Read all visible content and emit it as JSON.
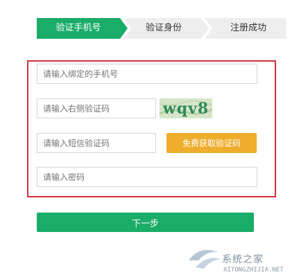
{
  "stepper": {
    "steps": [
      {
        "label": "验证手机号",
        "active": true
      },
      {
        "label": "验证身份",
        "active": false
      },
      {
        "label": "注册成功",
        "active": false
      }
    ]
  },
  "form": {
    "phone_placeholder": "请输入绑定的手机号",
    "captcha_placeholder": "请输入右侧验证码",
    "captcha_text": "wqv8",
    "sms_placeholder": "请输入短信验证码",
    "sms_button_label": "免费获取验证码",
    "password_placeholder": "请输入密码"
  },
  "next_button_label": "下一步",
  "watermark": {
    "text": "系统之家",
    "sub": "XITONGZHIJIA.NET"
  },
  "colors": {
    "accent_green": "#1aac69",
    "highlight_red": "#d42f3a",
    "button_orange": "#efad2c",
    "step_inactive": "#eeeeee"
  }
}
